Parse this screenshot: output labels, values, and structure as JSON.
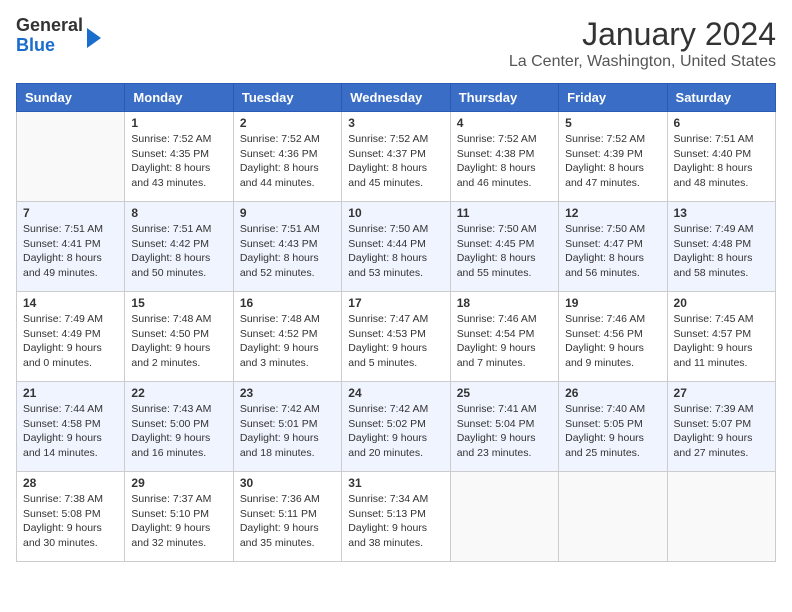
{
  "logo": {
    "general": "General",
    "blue": "Blue"
  },
  "title": "January 2024",
  "subtitle": "La Center, Washington, United States",
  "weekdays": [
    "Sunday",
    "Monday",
    "Tuesday",
    "Wednesday",
    "Thursday",
    "Friday",
    "Saturday"
  ],
  "weeks": [
    [
      {
        "day": "",
        "info": ""
      },
      {
        "day": "1",
        "info": "Sunrise: 7:52 AM\nSunset: 4:35 PM\nDaylight: 8 hours\nand 43 minutes."
      },
      {
        "day": "2",
        "info": "Sunrise: 7:52 AM\nSunset: 4:36 PM\nDaylight: 8 hours\nand 44 minutes."
      },
      {
        "day": "3",
        "info": "Sunrise: 7:52 AM\nSunset: 4:37 PM\nDaylight: 8 hours\nand 45 minutes."
      },
      {
        "day": "4",
        "info": "Sunrise: 7:52 AM\nSunset: 4:38 PM\nDaylight: 8 hours\nand 46 minutes."
      },
      {
        "day": "5",
        "info": "Sunrise: 7:52 AM\nSunset: 4:39 PM\nDaylight: 8 hours\nand 47 minutes."
      },
      {
        "day": "6",
        "info": "Sunrise: 7:51 AM\nSunset: 4:40 PM\nDaylight: 8 hours\nand 48 minutes."
      }
    ],
    [
      {
        "day": "7",
        "info": "Sunrise: 7:51 AM\nSunset: 4:41 PM\nDaylight: 8 hours\nand 49 minutes."
      },
      {
        "day": "8",
        "info": "Sunrise: 7:51 AM\nSunset: 4:42 PM\nDaylight: 8 hours\nand 50 minutes."
      },
      {
        "day": "9",
        "info": "Sunrise: 7:51 AM\nSunset: 4:43 PM\nDaylight: 8 hours\nand 52 minutes."
      },
      {
        "day": "10",
        "info": "Sunrise: 7:50 AM\nSunset: 4:44 PM\nDaylight: 8 hours\nand 53 minutes."
      },
      {
        "day": "11",
        "info": "Sunrise: 7:50 AM\nSunset: 4:45 PM\nDaylight: 8 hours\nand 55 minutes."
      },
      {
        "day": "12",
        "info": "Sunrise: 7:50 AM\nSunset: 4:47 PM\nDaylight: 8 hours\nand 56 minutes."
      },
      {
        "day": "13",
        "info": "Sunrise: 7:49 AM\nSunset: 4:48 PM\nDaylight: 8 hours\nand 58 minutes."
      }
    ],
    [
      {
        "day": "14",
        "info": "Sunrise: 7:49 AM\nSunset: 4:49 PM\nDaylight: 9 hours\nand 0 minutes."
      },
      {
        "day": "15",
        "info": "Sunrise: 7:48 AM\nSunset: 4:50 PM\nDaylight: 9 hours\nand 2 minutes."
      },
      {
        "day": "16",
        "info": "Sunrise: 7:48 AM\nSunset: 4:52 PM\nDaylight: 9 hours\nand 3 minutes."
      },
      {
        "day": "17",
        "info": "Sunrise: 7:47 AM\nSunset: 4:53 PM\nDaylight: 9 hours\nand 5 minutes."
      },
      {
        "day": "18",
        "info": "Sunrise: 7:46 AM\nSunset: 4:54 PM\nDaylight: 9 hours\nand 7 minutes."
      },
      {
        "day": "19",
        "info": "Sunrise: 7:46 AM\nSunset: 4:56 PM\nDaylight: 9 hours\nand 9 minutes."
      },
      {
        "day": "20",
        "info": "Sunrise: 7:45 AM\nSunset: 4:57 PM\nDaylight: 9 hours\nand 11 minutes."
      }
    ],
    [
      {
        "day": "21",
        "info": "Sunrise: 7:44 AM\nSunset: 4:58 PM\nDaylight: 9 hours\nand 14 minutes."
      },
      {
        "day": "22",
        "info": "Sunrise: 7:43 AM\nSunset: 5:00 PM\nDaylight: 9 hours\nand 16 minutes."
      },
      {
        "day": "23",
        "info": "Sunrise: 7:42 AM\nSunset: 5:01 PM\nDaylight: 9 hours\nand 18 minutes."
      },
      {
        "day": "24",
        "info": "Sunrise: 7:42 AM\nSunset: 5:02 PM\nDaylight: 9 hours\nand 20 minutes."
      },
      {
        "day": "25",
        "info": "Sunrise: 7:41 AM\nSunset: 5:04 PM\nDaylight: 9 hours\nand 23 minutes."
      },
      {
        "day": "26",
        "info": "Sunrise: 7:40 AM\nSunset: 5:05 PM\nDaylight: 9 hours\nand 25 minutes."
      },
      {
        "day": "27",
        "info": "Sunrise: 7:39 AM\nSunset: 5:07 PM\nDaylight: 9 hours\nand 27 minutes."
      }
    ],
    [
      {
        "day": "28",
        "info": "Sunrise: 7:38 AM\nSunset: 5:08 PM\nDaylight: 9 hours\nand 30 minutes."
      },
      {
        "day": "29",
        "info": "Sunrise: 7:37 AM\nSunset: 5:10 PM\nDaylight: 9 hours\nand 32 minutes."
      },
      {
        "day": "30",
        "info": "Sunrise: 7:36 AM\nSunset: 5:11 PM\nDaylight: 9 hours\nand 35 minutes."
      },
      {
        "day": "31",
        "info": "Sunrise: 7:34 AM\nSunset: 5:13 PM\nDaylight: 9 hours\nand 38 minutes."
      },
      {
        "day": "",
        "info": ""
      },
      {
        "day": "",
        "info": ""
      },
      {
        "day": "",
        "info": ""
      }
    ]
  ]
}
